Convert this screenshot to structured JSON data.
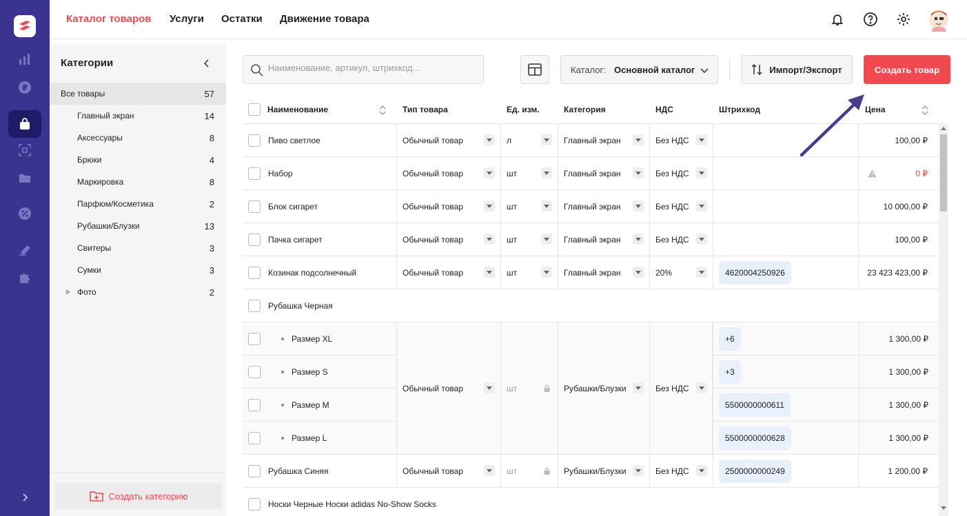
{
  "top_tabs": [
    "Каталог товаров",
    "Услуги",
    "Остатки",
    "Движение товара"
  ],
  "sidebar": {
    "title": "Категории",
    "categories": [
      {
        "name": "Все товары",
        "count": "57"
      },
      {
        "name": "Главный экран",
        "count": "14"
      },
      {
        "name": "Аксессуары",
        "count": "8"
      },
      {
        "name": "Брюки",
        "count": "4"
      },
      {
        "name": "Маркировка",
        "count": "8"
      },
      {
        "name": "Парфюм/Косметика",
        "count": "2"
      },
      {
        "name": "Рубашки/Блузки",
        "count": "13"
      },
      {
        "name": "Свитеры",
        "count": "3"
      },
      {
        "name": "Сумки",
        "count": "3"
      },
      {
        "name": "Фото",
        "count": "2"
      }
    ],
    "create_category": "Создать категорию"
  },
  "toolbar": {
    "search_placeholder": "Наименование, артикул, штрихкод...",
    "catalog_label": "Каталог:",
    "catalog_value": "Основной каталог",
    "import_export": "Импорт/Экспорт",
    "create_product": "Создать товар"
  },
  "table": {
    "headers": [
      "Наименование",
      "Тип товара",
      "Ед. изм.",
      "Категория",
      "НДС",
      "Штрихкод",
      "Цена"
    ],
    "rows": [
      {
        "name": "Пиво светлое",
        "type": "Обычный товар",
        "unit": "л",
        "category": "Главный экран",
        "vat": "Без НДС",
        "barcode": "",
        "price": "100,00 ₽"
      },
      {
        "name": "Набор",
        "type": "Обычный товар",
        "unit": "шт",
        "category": "Главный экран",
        "vat": "Без НДС",
        "barcode": "",
        "price": "0 ₽"
      },
      {
        "name": "Блок сигарет",
        "type": "Обычный товар",
        "unit": "шт",
        "category": "Главный экран",
        "vat": "Без НДС",
        "barcode": "",
        "price": "10 000,00 ₽"
      },
      {
        "name": "Пачка сигарет",
        "type": "Обычный товар",
        "unit": "шт",
        "category": "Главный экран",
        "vat": "Без НДС",
        "barcode": "",
        "price": "100,00 ₽"
      },
      {
        "name": "Козинак подсолнечный",
        "type": "Обычный товар",
        "unit": "шт",
        "category": "Главный экран",
        "vat": "20%",
        "barcode": "4620004250926",
        "price": "23 423 423,00 ₽"
      }
    ],
    "group": {
      "name": "Рубашка Черная",
      "type": "Обычный товар",
      "unit": "шт",
      "category": "Рубашки/Блузки",
      "vat": "Без НДС",
      "variants": [
        {
          "name": "Размер XL",
          "barcode": "+6",
          "price": "1 300,00 ₽"
        },
        {
          "name": "Размер S",
          "barcode": "+3",
          "price": "1 300,00 ₽"
        },
        {
          "name": "Размер M",
          "barcode": "5500000000611",
          "price": "1 300,00 ₽"
        },
        {
          "name": "Размер L",
          "barcode": "5500000000628",
          "price": "1 300,00 ₽"
        }
      ]
    },
    "after": [
      {
        "name": "Рубашка Синяя",
        "type": "Обычный товар",
        "unit": "шт",
        "category": "Рубашки/Блузки",
        "vat": "Без НДС",
        "barcode": "2500000000249",
        "price": "1 200,00 ₽"
      }
    ],
    "last_row": "Носки Черные Носки adidas No-Show Socks"
  },
  "colors": {
    "accent": "#f0494f",
    "rail": "#3a3490",
    "rail_active": "#1f1b66",
    "arrow": "#4a3b8f"
  }
}
